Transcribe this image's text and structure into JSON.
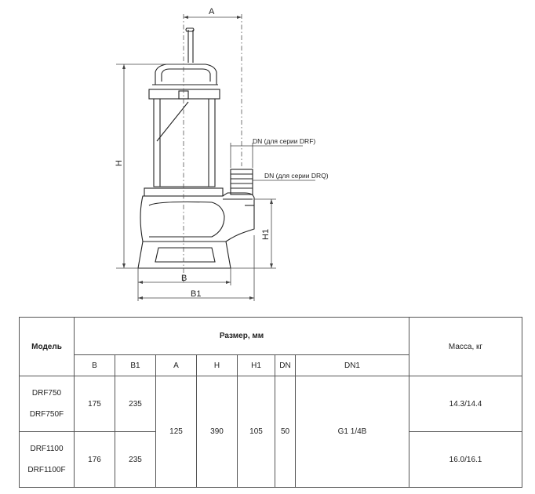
{
  "drawing": {
    "labels": {
      "A": "A",
      "H": "H",
      "H1": "H1",
      "B": "B",
      "B1": "B1",
      "dn_drf": "DN (для серии DRF)",
      "dn_drq": "DN (для серии DRQ)"
    }
  },
  "table": {
    "model_header": "Модель",
    "size_header": "Размер, мм",
    "mass_header": "Масса, кг",
    "columns": [
      "B",
      "B1",
      "A",
      "H",
      "H1",
      "DN",
      "DN1"
    ],
    "rows": [
      {
        "models": [
          "DRF750",
          "DRF750F"
        ],
        "B": "175",
        "B1": "235",
        "mass": "14.3/14.4"
      },
      {
        "models": [
          "DRF1100",
          "DRF1100F"
        ],
        "B": "176",
        "B1": "235",
        "mass": "16.0/16.1"
      }
    ],
    "shared": {
      "A": "125",
      "H": "390",
      "H1": "105",
      "DN": "50",
      "DN1": "G1 1/4B"
    }
  }
}
